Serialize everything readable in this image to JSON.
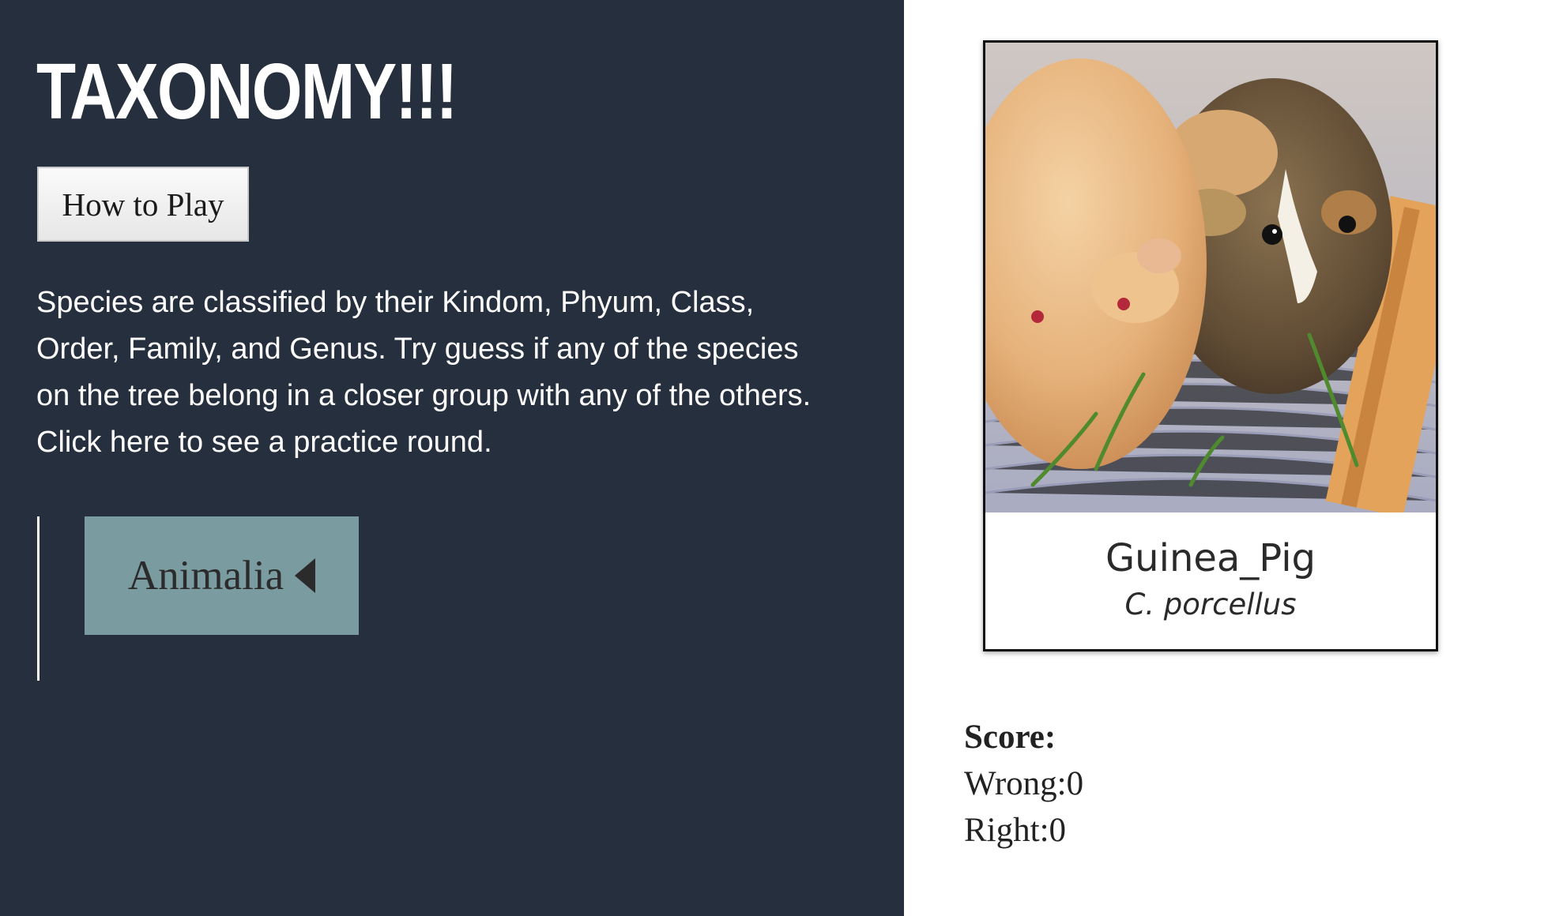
{
  "header": {
    "title": "TAXONOMY!!!"
  },
  "help": {
    "button_label": "How to Play"
  },
  "instructions": {
    "text": "Species are classified by their Kindom, Phyum, Class, Order, Family, and Genus. Try guess if any of the species on the tree belong in a closer group with any of the others. Click here to see a practice round."
  },
  "tree": {
    "root_label": "Animalia",
    "root_icon": "caret-left-icon"
  },
  "card": {
    "common_name": "Guinea_Pig",
    "scientific_name": "C. porcellus",
    "image_icon": "guinea-pig-photo"
  },
  "score": {
    "title": "Score:",
    "wrong_label": "Wrong:",
    "wrong_value": "0",
    "right_label": "Right:",
    "right_value": "0"
  },
  "colors": {
    "panel_bg": "#262f3e",
    "node_bg": "#7a9ba0",
    "text_light": "#ffffff"
  }
}
